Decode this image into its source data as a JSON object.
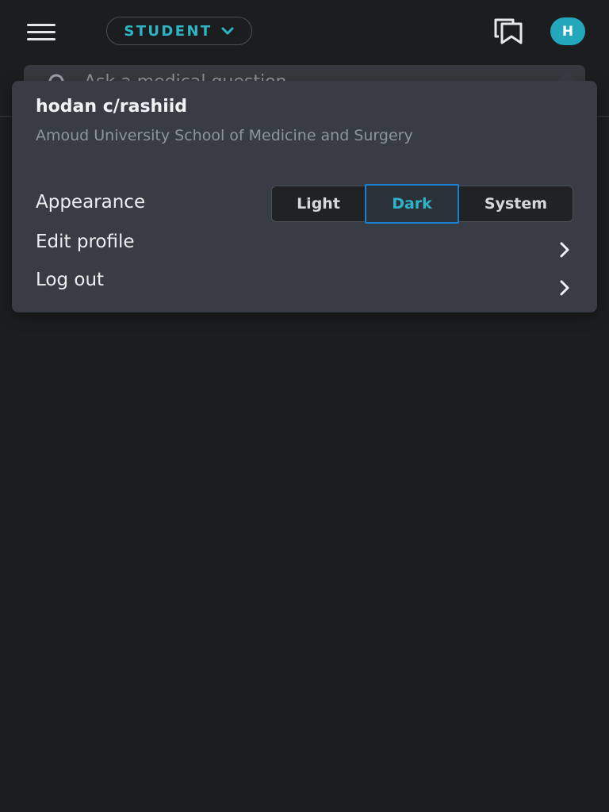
{
  "header": {
    "role_label": "STUDENT",
    "avatar_initial": "H"
  },
  "search": {
    "placeholder": "Ask a medical question"
  },
  "profile_menu": {
    "user_name": "hodan c/rashiid",
    "school": "Amoud University School of Medicine and Surgery",
    "appearance_label": "Appearance",
    "appearance_options": [
      "Light",
      "Dark",
      "System"
    ],
    "appearance_selected": "Dark",
    "edit_profile_label": "Edit profile",
    "logout_label": "Log out"
  },
  "icons": {
    "menu": "hamburger-menu-icon",
    "role_dropdown": "chevron-down-icon",
    "bookmarks": "bookmarks-icon",
    "search": "search-icon",
    "row_arrow": "chevron-right-icon"
  },
  "colors": {
    "background": "#1c1d1e",
    "popover": "#383c44",
    "accent": "#2fb4c7",
    "avatar": "#22a7bd",
    "selected_border": "#1a82d6"
  }
}
